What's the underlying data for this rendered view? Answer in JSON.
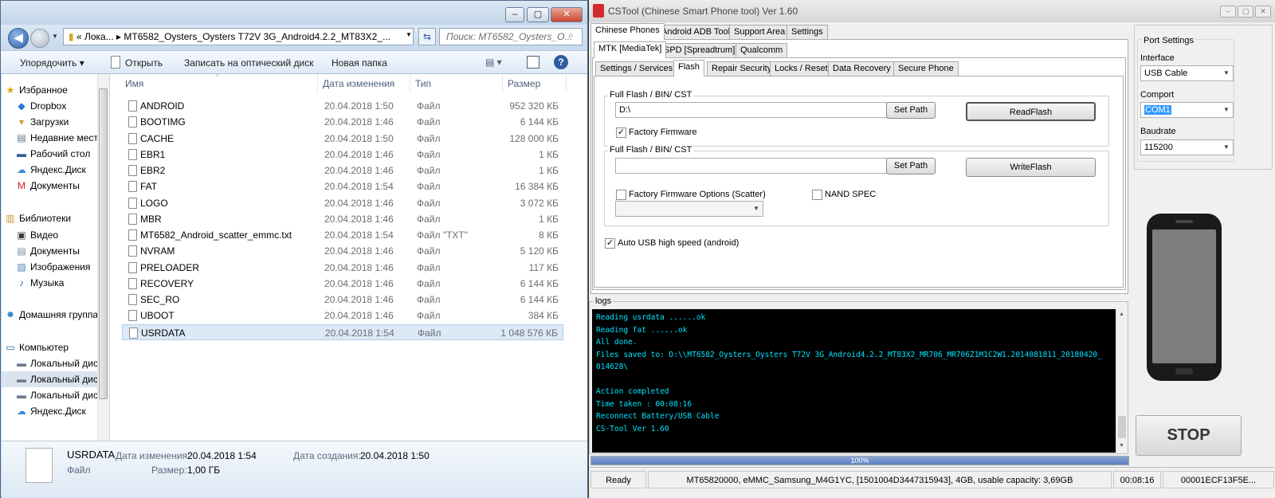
{
  "explorer": {
    "address": "«  Лока...  ▸  MT6582_Oysters_Oysters T72V 3G_Android4.2.2_MT83X2_...",
    "search_placeholder": "Поиск: MT6582_Oysters_O...",
    "toolbar": {
      "organize": "Упорядочить",
      "open": "Открыть",
      "burn": "Записать на оптический диск",
      "new_folder": "Новая папка"
    },
    "nav": [
      {
        "label": "Избранное",
        "icon": "star-icon",
        "glyph": "★",
        "color": "#e0a800",
        "top": true
      },
      {
        "label": "Dropbox",
        "icon": "dropbox-icon",
        "glyph": "◆",
        "color": "#1f7ad8"
      },
      {
        "label": "Загрузки",
        "icon": "downloads-icon",
        "glyph": "▾",
        "color": "#c89a2c"
      },
      {
        "label": "Недавние места",
        "icon": "recent-places-icon",
        "glyph": "▤",
        "color": "#5a6f8c"
      },
      {
        "label": "Рабочий стол",
        "icon": "desktop-icon",
        "glyph": "▬",
        "color": "#2d5e9e"
      },
      {
        "label": "Яндекс.Диск",
        "icon": "yandex-disk-icon",
        "glyph": "☁",
        "color": "#3b8ad6"
      },
      {
        "label": "Документы",
        "icon": "documents-icon",
        "glyph": "M",
        "color": "#d62020"
      },
      {
        "label": "Библиотеки",
        "icon": "libraries-icon",
        "glyph": "▥",
        "color": "#c89a2c",
        "top": true
      },
      {
        "label": "Видео",
        "icon": "video-icon",
        "glyph": "▣",
        "color": "#3a3a3a"
      },
      {
        "label": "Документы",
        "icon": "library-documents-icon",
        "glyph": "▤",
        "color": "#7a8ba3"
      },
      {
        "label": "Изображения",
        "icon": "pictures-icon",
        "glyph": "▨",
        "color": "#4f7fb8"
      },
      {
        "label": "Музыка",
        "icon": "music-icon",
        "glyph": "♪",
        "color": "#2b6cc4"
      },
      {
        "label": "Домашняя группа",
        "icon": "homegroup-icon",
        "glyph": "✸",
        "color": "#2a8fd0",
        "top": true
      },
      {
        "label": "Компьютер",
        "icon": "computer-icon",
        "glyph": "▭",
        "color": "#2d5e9e",
        "top": true
      },
      {
        "label": "Локальный диск",
        "icon": "local-disk-icon",
        "glyph": "▬",
        "color": "#6b7b8c"
      },
      {
        "label": "Локальный диск",
        "icon": "local-disk-icon",
        "glyph": "▬",
        "color": "#6b7b8c",
        "selected": true
      },
      {
        "label": "Локальный диск",
        "icon": "local-disk-icon",
        "glyph": "▬",
        "color": "#6b7b8c"
      },
      {
        "label": "Яндекс.Диск",
        "icon": "yandex-disk-icon",
        "glyph": "☁",
        "color": "#3b8ad6"
      }
    ],
    "columns": {
      "name": "Имя",
      "date": "Дата изменения",
      "type": "Тип",
      "size": "Размер"
    },
    "files": [
      {
        "name": "ANDROID",
        "date": "20.04.2018 1:50",
        "type": "Файл",
        "size": "952 320 КБ"
      },
      {
        "name": "BOOTIMG",
        "date": "20.04.2018 1:46",
        "type": "Файл",
        "size": "6 144 КБ"
      },
      {
        "name": "CACHE",
        "date": "20.04.2018 1:50",
        "type": "Файл",
        "size": "128 000 КБ"
      },
      {
        "name": "EBR1",
        "date": "20.04.2018 1:46",
        "type": "Файл",
        "size": "1 КБ"
      },
      {
        "name": "EBR2",
        "date": "20.04.2018 1:46",
        "type": "Файл",
        "size": "1 КБ"
      },
      {
        "name": "FAT",
        "date": "20.04.2018 1:54",
        "type": "Файл",
        "size": "16 384 КБ"
      },
      {
        "name": "LOGO",
        "date": "20.04.2018 1:46",
        "type": "Файл",
        "size": "3 072 КБ"
      },
      {
        "name": "MBR",
        "date": "20.04.2018 1:46",
        "type": "Файл",
        "size": "1 КБ"
      },
      {
        "name": "MT6582_Android_scatter_emmc.txt",
        "date": "20.04.2018 1:54",
        "type": "Файл \"TXT\"",
        "size": "8 КБ"
      },
      {
        "name": "NVRAM",
        "date": "20.04.2018 1:46",
        "type": "Файл",
        "size": "5 120 КБ"
      },
      {
        "name": "PRELOADER",
        "date": "20.04.2018 1:46",
        "type": "Файл",
        "size": "117 КБ"
      },
      {
        "name": "RECOVERY",
        "date": "20.04.2018 1:46",
        "type": "Файл",
        "size": "6 144 КБ"
      },
      {
        "name": "SEC_RO",
        "date": "20.04.2018 1:46",
        "type": "Файл",
        "size": "6 144 КБ"
      },
      {
        "name": "UBOOT",
        "date": "20.04.2018 1:46",
        "type": "Файл",
        "size": "384 КБ"
      },
      {
        "name": "USRDATA",
        "date": "20.04.2018 1:54",
        "type": "Файл",
        "size": "1 048 576 КБ",
        "selected": true
      }
    ],
    "details": {
      "name": "USRDATA",
      "kind": "Файл",
      "modified_label": "Дата изменения:",
      "modified_value": "20.04.2018 1:54",
      "created_label": "Дата создания:",
      "created_value": "20.04.2018 1:50",
      "size_label": "Размер:",
      "size_value": "1,00 ГБ"
    }
  },
  "cstool": {
    "title": "CSTool (Chinese Smart Phone tool)  Ver 1.60",
    "main_tabs": [
      "Chinese Phones",
      "Android ADB Tool",
      "Support Area",
      "Settings"
    ],
    "vendor_tabs": [
      "MTK [MediaTek]",
      "SPD [Spreadtrum]",
      "Qualcomm"
    ],
    "func_tabs": [
      "Settings / Services",
      "Flash",
      "Repair Security",
      "Locks / Reset",
      "Data Recovery",
      "Secure Phone"
    ],
    "read_group": {
      "label": "Full Flash / BIN/ CST",
      "path": "D:\\",
      "set_path": "Set Path",
      "action": "ReadFlash",
      "factory_firmware": "Factory Firmware"
    },
    "write_group": {
      "label": "Full Flash / BIN/ CST",
      "path": "",
      "set_path": "Set Path",
      "action": "WriteFlash",
      "factory_options": "Factory Firmware Options (Scatter)",
      "nand_spec": "NAND SPEC"
    },
    "auto_usb": "Auto USB high speed (android)",
    "port": {
      "title": "Port Settings",
      "interface_label": "Interface",
      "interface_value": "USB Cable",
      "comport_label": "Comport",
      "comport_value": "COM1",
      "baud_label": "Baudrate",
      "baud_value": "115200"
    },
    "stop": "STOP",
    "logs_label": "logs",
    "log_lines": [
      "Reading usrdata ......ok",
      "Reading fat ......ok",
      "All done.",
      "Files saved to: D:\\\\MT6582_Oysters_Oysters T72V 3G_Android4.2.2_MT83X2_MR706_MR706Z1M1C2W1.2014081811_20180420_",
      "014628\\",
      "",
      "Action completed",
      "Time taken : 00:08:16",
      "Reconnect Battery/USB Cable",
      "CS-Tool Ver 1.60"
    ],
    "progress": {
      "text": "100%",
      "fraction": 1.0
    },
    "status": {
      "state": "Ready",
      "device": "MT65820000, eMMC_Samsung_M4G1YC, [1501004D3447315943], 4GB, usable capacity: 3,69GB",
      "time": "00:08:16",
      "serial": "00001ECF13F5E..."
    }
  }
}
